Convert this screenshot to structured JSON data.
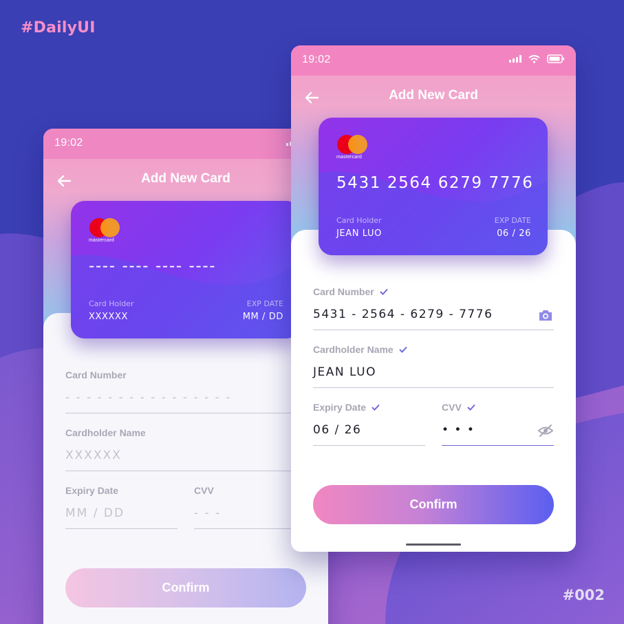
{
  "page": {
    "tag_top": "#DailyUI",
    "tag_bottom": "#002"
  },
  "colors": {
    "background": "#3a3fb3",
    "accent_pink": "#f285c1",
    "accent_purple": "#6f6ad9",
    "card_gradient_start": "#9333ea",
    "card_gradient_end": "#5d62ee"
  },
  "empty_screen": {
    "status_time": "19:02",
    "title": "Add New Card",
    "card": {
      "brand": "mastercard",
      "number": "---- ---- ---- ----",
      "holder_label": "Card Holder",
      "holder_value": "XXXXXX",
      "exp_label": "EXP DATE",
      "exp_value": "MM / DD"
    },
    "form": {
      "card_number_label": "Card Number",
      "card_number_value": "- - - -   - - - -   - - - -   - - - -",
      "cardholder_label": "Cardholder Name",
      "cardholder_value": "XXXXXX",
      "expiry_label": "Expiry Date",
      "expiry_value": "MM / DD",
      "cvv_label": "CVV",
      "cvv_value": "- - -"
    },
    "confirm_label": "Confirm"
  },
  "filled_screen": {
    "status_time": "19:02",
    "title": "Add New Card",
    "card": {
      "brand": "mastercard",
      "number": "5431 2564 6279 7776",
      "holder_label": "Card Holder",
      "holder_value": "JEAN LUO",
      "exp_label": "EXP DATE",
      "exp_value": "06 / 26"
    },
    "form": {
      "card_number_label": "Card Number",
      "card_number_value": "5431 - 2564 - 6279 - 7776",
      "cardholder_label": "Cardholder Name",
      "cardholder_value": "JEAN LUO",
      "expiry_label": "Expiry Date",
      "expiry_value": "06 / 26",
      "cvv_label": "CVV",
      "cvv_value": "• • •"
    },
    "confirm_label": "Confirm"
  },
  "icons": {
    "back": "arrow-left-icon",
    "camera": "camera-icon",
    "hide": "eye-off-icon",
    "check": "check-icon",
    "signal": "signal-icon",
    "wifi": "wifi-icon",
    "battery": "battery-icon"
  }
}
